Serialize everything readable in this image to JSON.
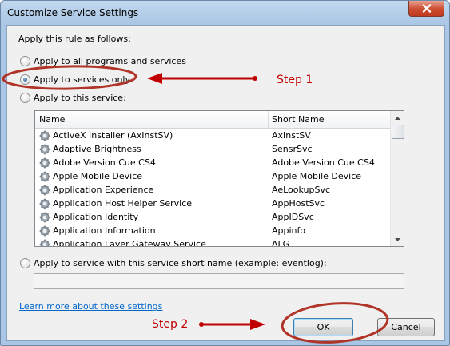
{
  "window": {
    "title": "Customize Service Settings",
    "close_label": "Close"
  },
  "section_label": "Apply this rule as follows:",
  "options": [
    {
      "label": "Apply to all programs and services",
      "checked": false
    },
    {
      "label": "Apply to services only",
      "checked": true
    },
    {
      "label": "Apply to this service:",
      "checked": false
    },
    {
      "label": "Apply to service with this service short name (example: eventlog):",
      "checked": false
    }
  ],
  "services_table": {
    "columns": [
      "Name",
      "Short Name"
    ],
    "rows": [
      {
        "name": "ActiveX Installer (AxInstSV)",
        "short_name": "AxInstSV"
      },
      {
        "name": "Adaptive Brightness",
        "short_name": "SensrSvc"
      },
      {
        "name": "Adobe Version Cue CS4",
        "short_name": "Adobe Version Cue CS4"
      },
      {
        "name": "Apple Mobile Device",
        "short_name": "Apple Mobile Device"
      },
      {
        "name": "Application Experience",
        "short_name": "AeLookupSvc"
      },
      {
        "name": "Application Host Helper Service",
        "short_name": "AppHostSvc"
      },
      {
        "name": "Application Identity",
        "short_name": "AppIDSvc"
      },
      {
        "name": "Application Information",
        "short_name": "Appinfo"
      },
      {
        "name": "Application Layer Gateway Service",
        "short_name": "ALG"
      }
    ],
    "icon": "gear-service-icon"
  },
  "short_name_input": {
    "value": ""
  },
  "learn_more_link": "Learn more about these settings",
  "buttons": {
    "ok": "OK",
    "cancel": "Cancel"
  },
  "annotations": {
    "step1": "Step 1",
    "step2": "Step 2",
    "color": "#c00000"
  },
  "colors": {
    "title_bar": "#a9c6e4",
    "dialog_bg": "#f0f0f0",
    "link": "#0066cc",
    "close_button": "#c23a1f"
  }
}
